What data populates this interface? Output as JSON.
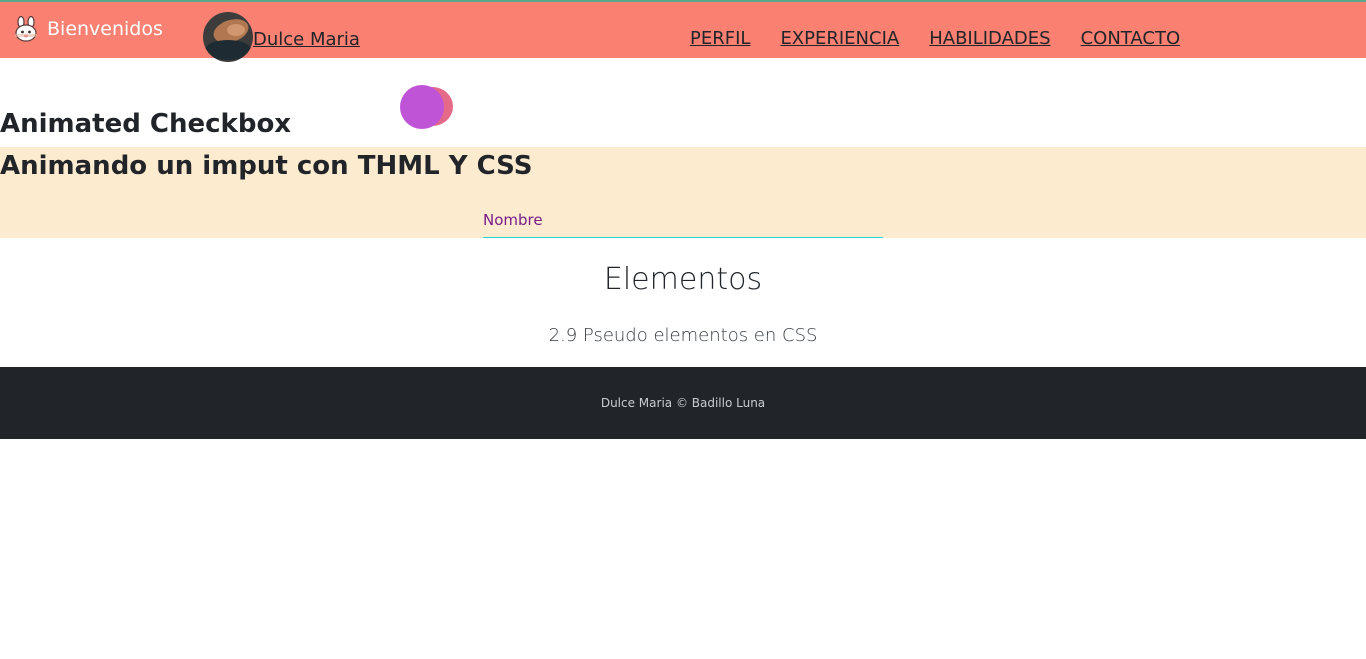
{
  "navbar": {
    "brand": {
      "icon": "bunny-logo-icon",
      "text": "Bienvenidos"
    },
    "profile": {
      "avatar": "profile-avatar-photo",
      "name": "Dulce Maria"
    },
    "links": [
      "PERFIL",
      "EXPERIENCIA",
      "HABILIDADES",
      "CONTACTO"
    ],
    "background_color": "#fa8072"
  },
  "checkbox_section": {
    "title": "Animated Checkbox",
    "toggle_colors": {
      "front": "#bf55d6",
      "back": "#e56a8a"
    }
  },
  "input_section": {
    "title": "Animando un imput con THML Y CSS",
    "field_label": "Nombre",
    "field_value": "",
    "background_color": "#fdebd0"
  },
  "elements_section": {
    "title": "Elementos",
    "subtitle": "2.9 Pseudo elementos en CSS"
  },
  "footer": {
    "text": "Dulce Maria © Badillo Luna",
    "background_color": "#212529"
  }
}
